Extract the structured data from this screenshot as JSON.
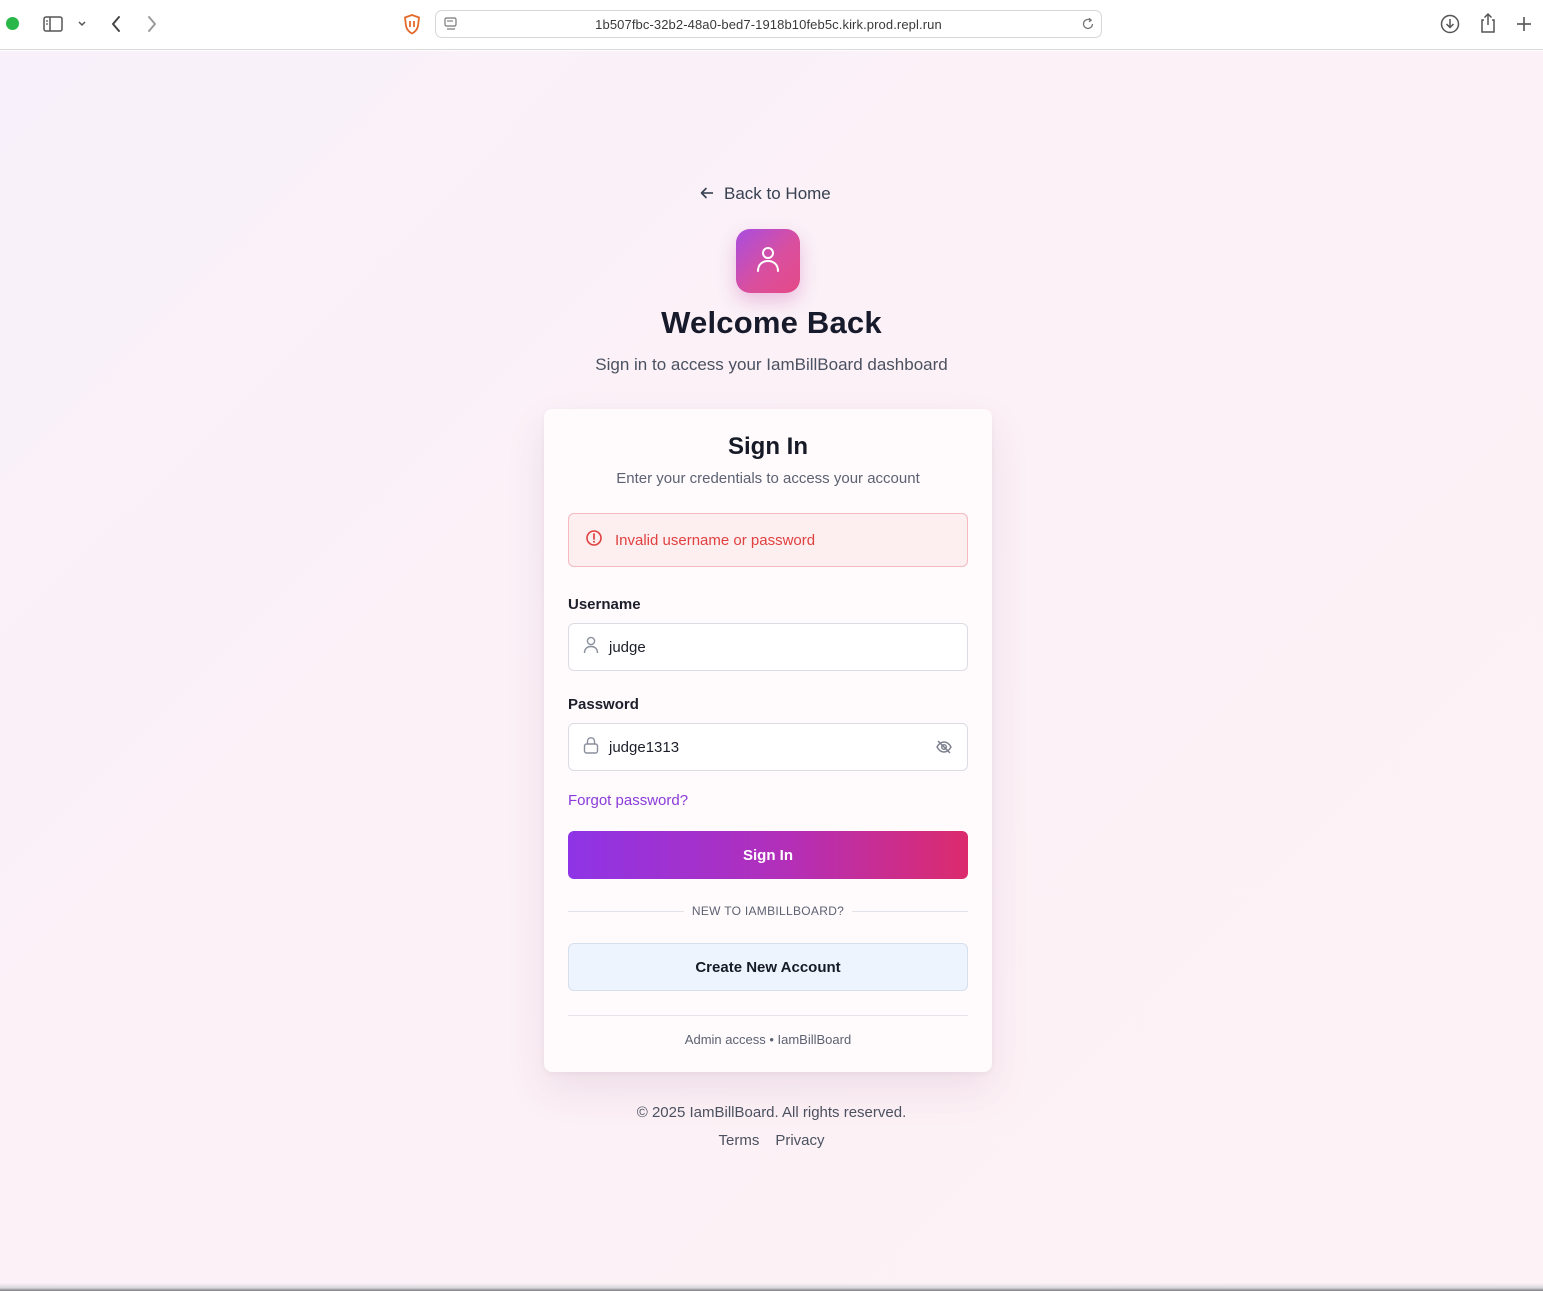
{
  "browser": {
    "url": "1b507fbc-32b2-48a0-bed7-1918b10feb5c.kirk.prod.repl.run",
    "icons": [
      "sidebar-toggle-icon",
      "chevron-down-icon",
      "back-arrow-icon",
      "forward-arrow-icon",
      "shield-icon",
      "page-settings-icon",
      "reload-icon",
      "download-icon",
      "share-icon",
      "new-tab-icon"
    ]
  },
  "header": {
    "back_label": "Back to Home",
    "title": "Welcome Back",
    "subtitle": "Sign in to access your IamBillBoard dashboard"
  },
  "card": {
    "title": "Sign In",
    "subtitle": "Enter your credentials to access your account",
    "error": "Invalid username or password",
    "username_label": "Username",
    "username_value": "judge",
    "password_label": "Password",
    "password_value": "judge1313",
    "forgot_label": "Forgot password?",
    "submit_label": "Sign In",
    "divider_text": "NEW TO IAMBILLBOARD?",
    "create_label": "Create New Account",
    "footer_text": "Admin access • IamBillBoard"
  },
  "footer": {
    "copyright": "© 2025 IamBillBoard. All rights reserved.",
    "links": [
      "Terms",
      "Privacy"
    ]
  },
  "colors": {
    "accent_start": "#8e34e6",
    "accent_end": "#dc2b6d",
    "error": "#e0413f",
    "link": "#8b3bd9"
  }
}
